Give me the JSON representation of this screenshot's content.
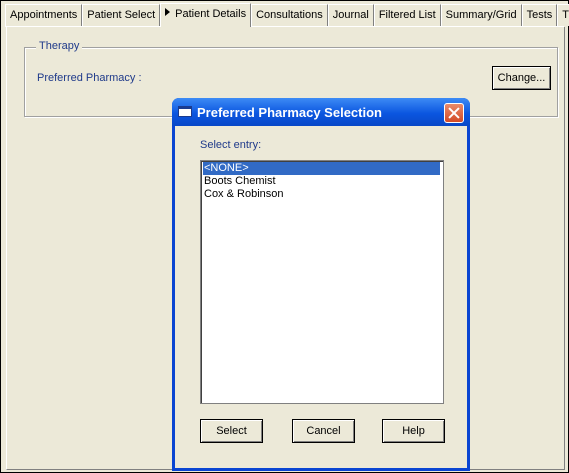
{
  "tabs": [
    {
      "label": "Appointments"
    },
    {
      "label": "Patient Select"
    },
    {
      "label": "Patient Details"
    },
    {
      "label": "Consultations"
    },
    {
      "label": "Journal"
    },
    {
      "label": "Filtered List"
    },
    {
      "label": "Summary/Grid"
    },
    {
      "label": "Tests"
    },
    {
      "label": "T"
    }
  ],
  "therapy": {
    "group_title": "Therapy",
    "preferred_pharmacy_label": "Preferred Pharmacy :",
    "change_button": "Change..."
  },
  "dialog": {
    "title": "Preferred Pharmacy Selection",
    "select_label": "Select entry:",
    "items": [
      {
        "label": "<NONE>",
        "selected": true
      },
      {
        "label": "Boots Chemist",
        "selected": false
      },
      {
        "label": "Cox & Robinson",
        "selected": false
      }
    ],
    "select_button": "Select",
    "cancel_button": "Cancel",
    "help_button": "Help"
  },
  "colors": {
    "dialog_title_blue": "#0b56e0",
    "selection_blue": "#316ac5",
    "label_blue": "#1f3a8a",
    "window_bg": "#ece9d8"
  }
}
